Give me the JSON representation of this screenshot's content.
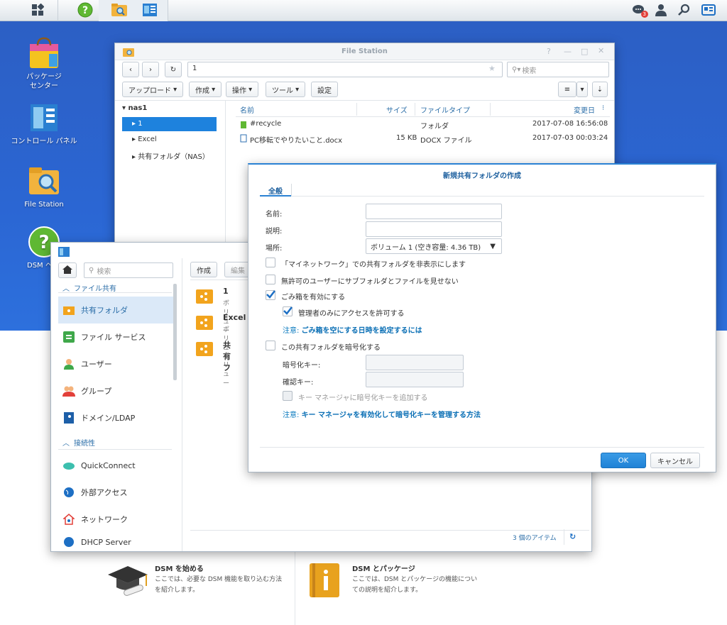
{
  "taskbar": {
    "notification_count": "3"
  },
  "desktop": {
    "icons": [
      {
        "label": "パッケージ\nセンター"
      },
      {
        "label": "コントロール パネル"
      },
      {
        "label": "File Station"
      },
      {
        "label": "DSM ヘ"
      }
    ]
  },
  "filestation": {
    "title": "File Station",
    "path": "1",
    "search_placeholder": "検索",
    "toolbar": {
      "upload": "アップロード",
      "create": "作成",
      "action": "操作",
      "tools": "ツール",
      "settings": "設定"
    },
    "tree": {
      "root": "nas1",
      "items": [
        "1",
        "Excel",
        "共有フォルダ（NAS）"
      ]
    },
    "columns": {
      "name": "名前",
      "size": "サイズ",
      "type": "ファイルタイプ",
      "modified": "変更日"
    },
    "rows": [
      {
        "name": "#recycle",
        "size": "",
        "type": "フォルダ",
        "modified": "2017-07-08 16:56:08"
      },
      {
        "name": "PC移転でやりたいこと.docx",
        "size": "15 KB",
        "type": "DOCX ファイル",
        "modified": "2017-07-03 00:03:24"
      }
    ]
  },
  "control": {
    "search_placeholder": "検索",
    "section_file_sharing": "ファイル共有",
    "section_connectivity": "接続性",
    "items": [
      "共有フォルダ",
      "ファイル サービス",
      "ユーザー",
      "グループ",
      "ドメイン/LDAP",
      "QuickConnect",
      "外部アクセス",
      "ネットワーク",
      "DHCP Server"
    ],
    "toolbar": {
      "create": "作成",
      "edit": "編集"
    },
    "folders": [
      {
        "name": "1",
        "desc": "ボリュー"
      },
      {
        "name": "Excel",
        "desc": "ボリュー"
      },
      {
        "name": "共有フ",
        "desc": "ボリュー"
      }
    ],
    "item_count": "3 個のアイテム"
  },
  "dialog": {
    "title": "新規共有フォルダの作成",
    "tab": "全般",
    "name_label": "名前:",
    "desc_label": "説明:",
    "location_label": "場所:",
    "location_value": "ボリューム 1 (空き容量: 4.36 TB)",
    "hide_network": "「マイネットワーク」での共有フォルダを非表示にします",
    "hide_unauthorized": "無許可のユーザーにサブフォルダとファイルを見せない",
    "enable_recycle": "ごみ箱を有効にする",
    "admin_only": "管理者のみにアクセスを許可する",
    "note1_prefix": "注意:",
    "note1_link": "ごみ箱を空にする日時を設定するには",
    "encrypt": "この共有フォルダを暗号化する",
    "enc_key_label": "暗号化キー:",
    "confirm_key_label": "確認キー:",
    "add_keymanager": "キー マネージャに暗号化キーを追加する",
    "note2_prefix": "注意:",
    "note2_link": "キー マネージャを有効化して暗号化キーを管理する方法",
    "ok": "OK",
    "cancel": "キャンセル"
  },
  "help": {
    "card1_title": "DSM を始める",
    "card1_desc1": "ここでは、必要な DSM 機能を取り込む方法",
    "card1_desc2": "を紹介します。",
    "card2_title": "DSM とパッケージ",
    "card2_desc1": "ここでは、DSM とパッケージの機能につい",
    "card2_desc2": "ての説明を紹介します。"
  }
}
